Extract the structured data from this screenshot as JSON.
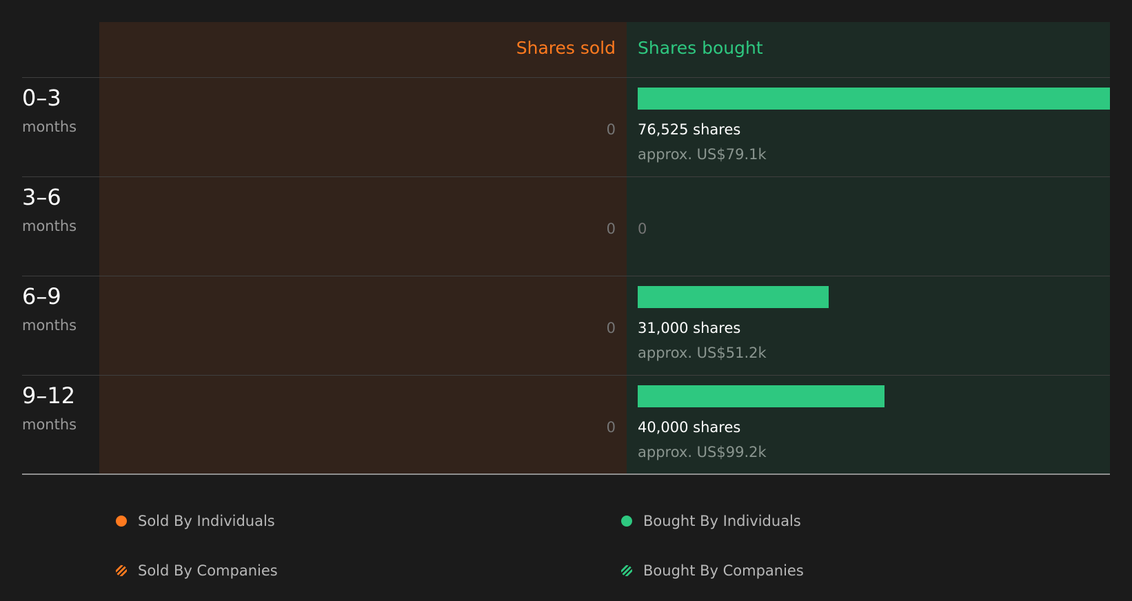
{
  "colors": {
    "sold": "#ff7a1f",
    "bought": "#2ec880",
    "background": "#1b1b1b",
    "sold_panel": "#32231b",
    "bought_panel": "#1c2b25"
  },
  "headers": {
    "sold": "Shares sold",
    "bought": "Shares bought"
  },
  "chart_data": {
    "type": "bar",
    "categories": [
      "0–3",
      "3–6",
      "6–9",
      "9–12"
    ],
    "category_unit": "months",
    "series": [
      {
        "name": "Shares sold",
        "values": [
          0,
          0,
          0,
          0
        ],
        "labels": [
          "0",
          "0",
          "0",
          "0"
        ]
      },
      {
        "name": "Shares bought",
        "values": [
          76525,
          0,
          31000,
          40000
        ],
        "labels": [
          "76,525 shares",
          "0",
          "31,000 shares",
          "40,000 shares"
        ],
        "approx_values": [
          "approx. US$79.1k",
          "",
          "approx. US$51.2k",
          "approx. US$99.2k"
        ]
      }
    ],
    "max_value": 76525,
    "legend": [
      {
        "label": "Sold By Individuals",
        "color": "#ff7a1f",
        "pattern": "solid"
      },
      {
        "label": "Bought By Individuals",
        "color": "#2ec880",
        "pattern": "solid"
      },
      {
        "label": "Sold By Companies",
        "color": "#ff7a1f",
        "pattern": "hatched"
      },
      {
        "label": "Bought By Companies",
        "color": "#2ec880",
        "pattern": "hatched"
      }
    ],
    "legend_position": "bottom"
  }
}
